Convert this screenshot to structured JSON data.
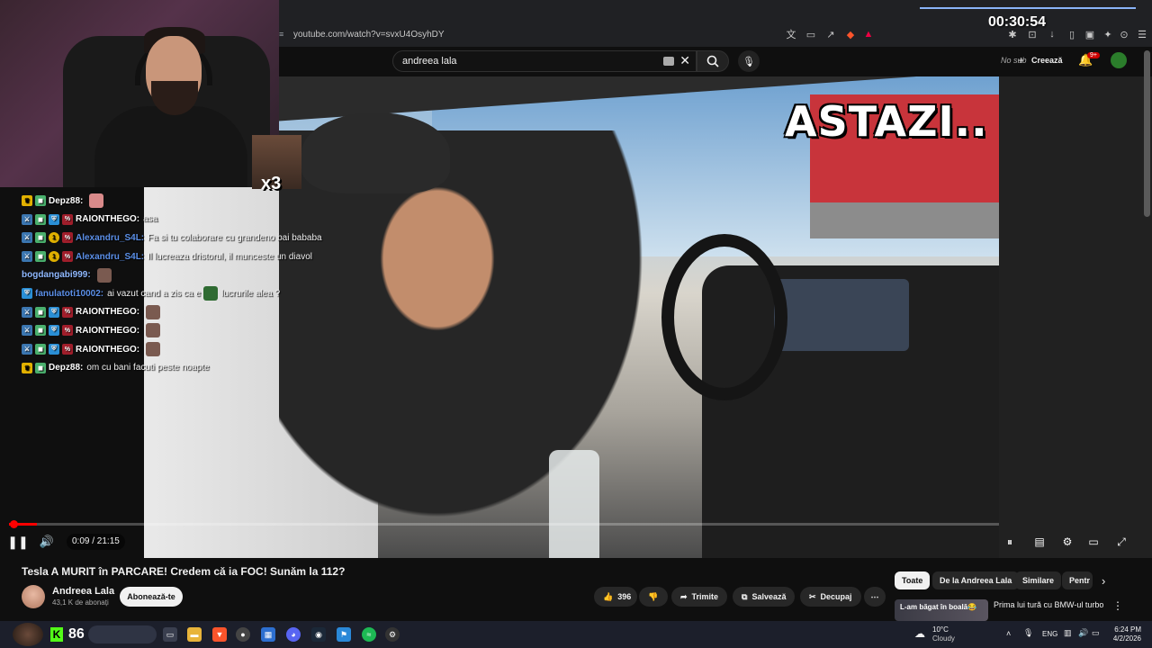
{
  "browser": {
    "url": "youtube.com/watch?v=svxU4OsyhDY"
  },
  "youtube": {
    "search_value": "andreea lala",
    "header_no_sub": "No sub",
    "header_create": "Creează",
    "notif_count": "9+"
  },
  "video": {
    "overlay_text": "ASTAZI..",
    "time_display": "0:09 / 21:15",
    "progress_fraction": 0.007,
    "title": "Tesla A MURIT în PARCARE! Credem că ia FOC! Sunăm la 112?"
  },
  "channel": {
    "name": "Andreea Lala",
    "subscribers": "43,1 K de abonați",
    "subscribe_label": "Abonează-te"
  },
  "actions": {
    "likes": "396",
    "share_label": "Trimite",
    "save_label": "Salvează",
    "clip_label": "Decupaj"
  },
  "chips": [
    "Toate",
    "De la Andreea Lala",
    "Similare",
    "Pentr"
  ],
  "recommendation": {
    "thumb_text": "L-am băgat în boală😂",
    "title": "Prima lui tură cu BMW-ul turbo"
  },
  "stream": {
    "timer": "00:30:54",
    "meme_count": "x3",
    "taskbar_counter": "86"
  },
  "chat": [
    {
      "user": "Depz88:",
      "color": "#ffffff",
      "msg": "",
      "badges": [
        "crown",
        "green"
      ],
      "emote": "pink"
    },
    {
      "user": "RAIONTHEGO:",
      "color": "#ffffff",
      "msg": "asa",
      "badges": [
        "sword",
        "green",
        "blue",
        "red"
      ],
      "emote": ""
    },
    {
      "user": "Alexandru_S4L:",
      "color": "#5b8fe8",
      "msg": "Fa si tu colaborare cu grandeno bai bababa",
      "badges": [
        "sword",
        "green",
        "gold",
        "red"
      ],
      "emote": ""
    },
    {
      "user": "Alexandru_S4L:",
      "color": "#5b8fe8",
      "msg": "Il lucreaza dristorul, il munceste un diavol",
      "badges": [
        "sword",
        "green",
        "gold",
        "red"
      ],
      "emote": ""
    },
    {
      "user": "bogdangabi999:",
      "color": "#8fb8ff",
      "msg": "",
      "badges": [],
      "emote": "brown"
    },
    {
      "user": "fanulatoti10002:",
      "color": "#5b8fe8",
      "msg": "ai vazut cand a zis ca e",
      "badges": [
        "blue"
      ],
      "emote": "green",
      "msg_after": "lucrurile alea ?"
    },
    {
      "user": "RAIONTHEGO:",
      "color": "#ffffff",
      "msg": "",
      "badges": [
        "sword",
        "green",
        "blue",
        "red"
      ],
      "emote": "brown"
    },
    {
      "user": "RAIONTHEGO:",
      "color": "#ffffff",
      "msg": "",
      "badges": [
        "sword",
        "green",
        "blue",
        "red"
      ],
      "emote": "brown"
    },
    {
      "user": "RAIONTHEGO:",
      "color": "#ffffff",
      "msg": "",
      "badges": [
        "sword",
        "green",
        "blue",
        "red"
      ],
      "emote": "brown"
    },
    {
      "user": "Depz88:",
      "color": "#ffffff",
      "msg": "om cu bani facuti peste noapte",
      "badges": [
        "crown",
        "green"
      ],
      "emote": ""
    }
  ],
  "taskbar": {
    "weather_temp": "10°C",
    "weather_cond": "Cloudy",
    "lang": "ENG",
    "time": "6:24 PM",
    "date": "4/2/2026"
  },
  "colors": {
    "accent": "#ff0000",
    "kick_green": "#53fc18"
  }
}
